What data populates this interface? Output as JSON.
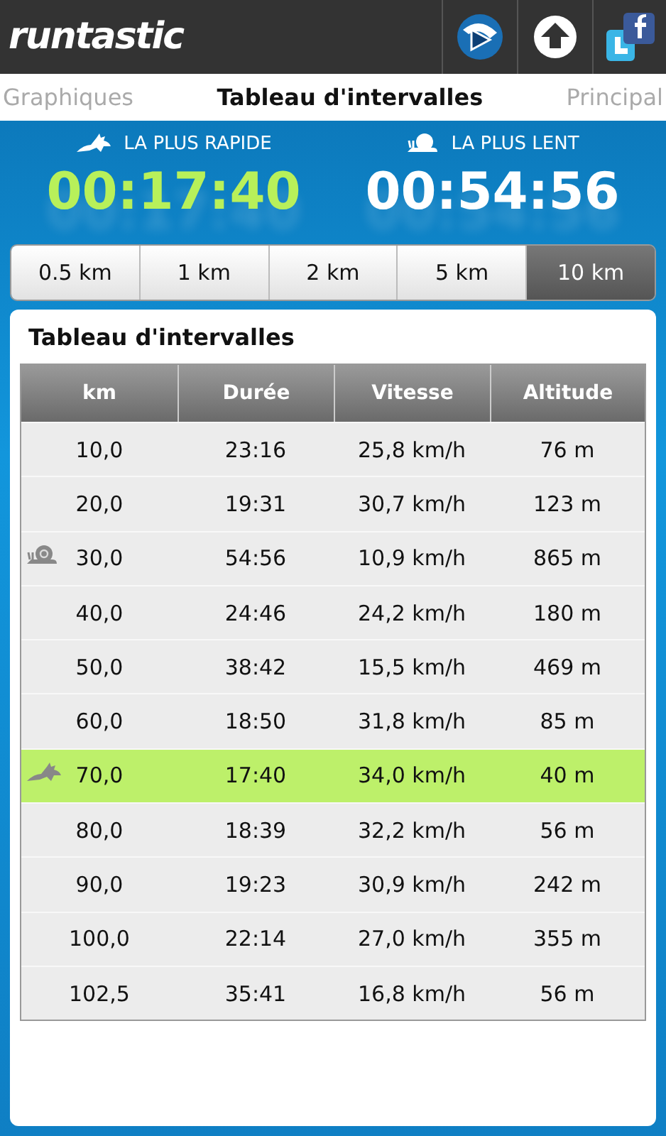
{
  "app_bar": {
    "logo": "runtastic",
    "actions": [
      {
        "kind": "play"
      },
      {
        "kind": "upload"
      },
      {
        "kind": "social"
      }
    ]
  },
  "tabs": [
    {
      "label": "Graphiques",
      "selected": false
    },
    {
      "label": "Tableau d'intervalles",
      "selected": true
    },
    {
      "label": "Principal",
      "selected": false
    }
  ],
  "summary": [
    {
      "kind": "fastest",
      "label": "LA PLUS RAPIDE",
      "time": "00:17:40"
    },
    {
      "kind": "slowest",
      "label": "LA PLUS LENT",
      "time": "00:54:56"
    }
  ],
  "intervals": [
    {
      "label": "0.5 km",
      "selected": false
    },
    {
      "label": "1 km",
      "selected": false
    },
    {
      "label": "2 km",
      "selected": false
    },
    {
      "label": "5 km",
      "selected": false
    },
    {
      "label": "10 km",
      "selected": true
    }
  ],
  "card": {
    "title": "Tableau d'intervalles",
    "table": {
      "columns": [
        "km",
        "Durée",
        "Vitesse",
        "Altitude"
      ],
      "rows": [
        {
          "kind": "plain",
          "highlighted": false,
          "cells": [
            "10,0",
            "23:16",
            "25,8 km/h",
            "76 m"
          ]
        },
        {
          "kind": "plain",
          "highlighted": false,
          "cells": [
            "20,0",
            "19:31",
            "30,7 km/h",
            "123 m"
          ]
        },
        {
          "kind": "slowest",
          "highlighted": false,
          "cells": [
            "30,0",
            "54:56",
            "10,9 km/h",
            "865 m"
          ]
        },
        {
          "kind": "plain",
          "highlighted": false,
          "cells": [
            "40,0",
            "24:46",
            "24,2 km/h",
            "180 m"
          ]
        },
        {
          "kind": "plain",
          "highlighted": false,
          "cells": [
            "50,0",
            "38:42",
            "15,5 km/h",
            "469 m"
          ]
        },
        {
          "kind": "plain",
          "highlighted": false,
          "cells": [
            "60,0",
            "18:50",
            "31,8 km/h",
            "85 m"
          ]
        },
        {
          "kind": "fastest",
          "highlighted": true,
          "cells": [
            "70,0",
            "17:40",
            "34,0 km/h",
            "40 m"
          ]
        },
        {
          "kind": "plain",
          "highlighted": false,
          "cells": [
            "80,0",
            "18:39",
            "32,2 km/h",
            "56 m"
          ]
        },
        {
          "kind": "plain",
          "highlighted": false,
          "cells": [
            "90,0",
            "19:23",
            "30,9 km/h",
            "242 m"
          ]
        },
        {
          "kind": "plain",
          "highlighted": false,
          "cells": [
            "100,0",
            "22:14",
            "27,0 km/h",
            "355 m"
          ]
        },
        {
          "kind": "plain",
          "highlighted": false,
          "cells": [
            "102,5",
            "35:41",
            "16,8 km/h",
            "56 m"
          ]
        }
      ]
    }
  }
}
